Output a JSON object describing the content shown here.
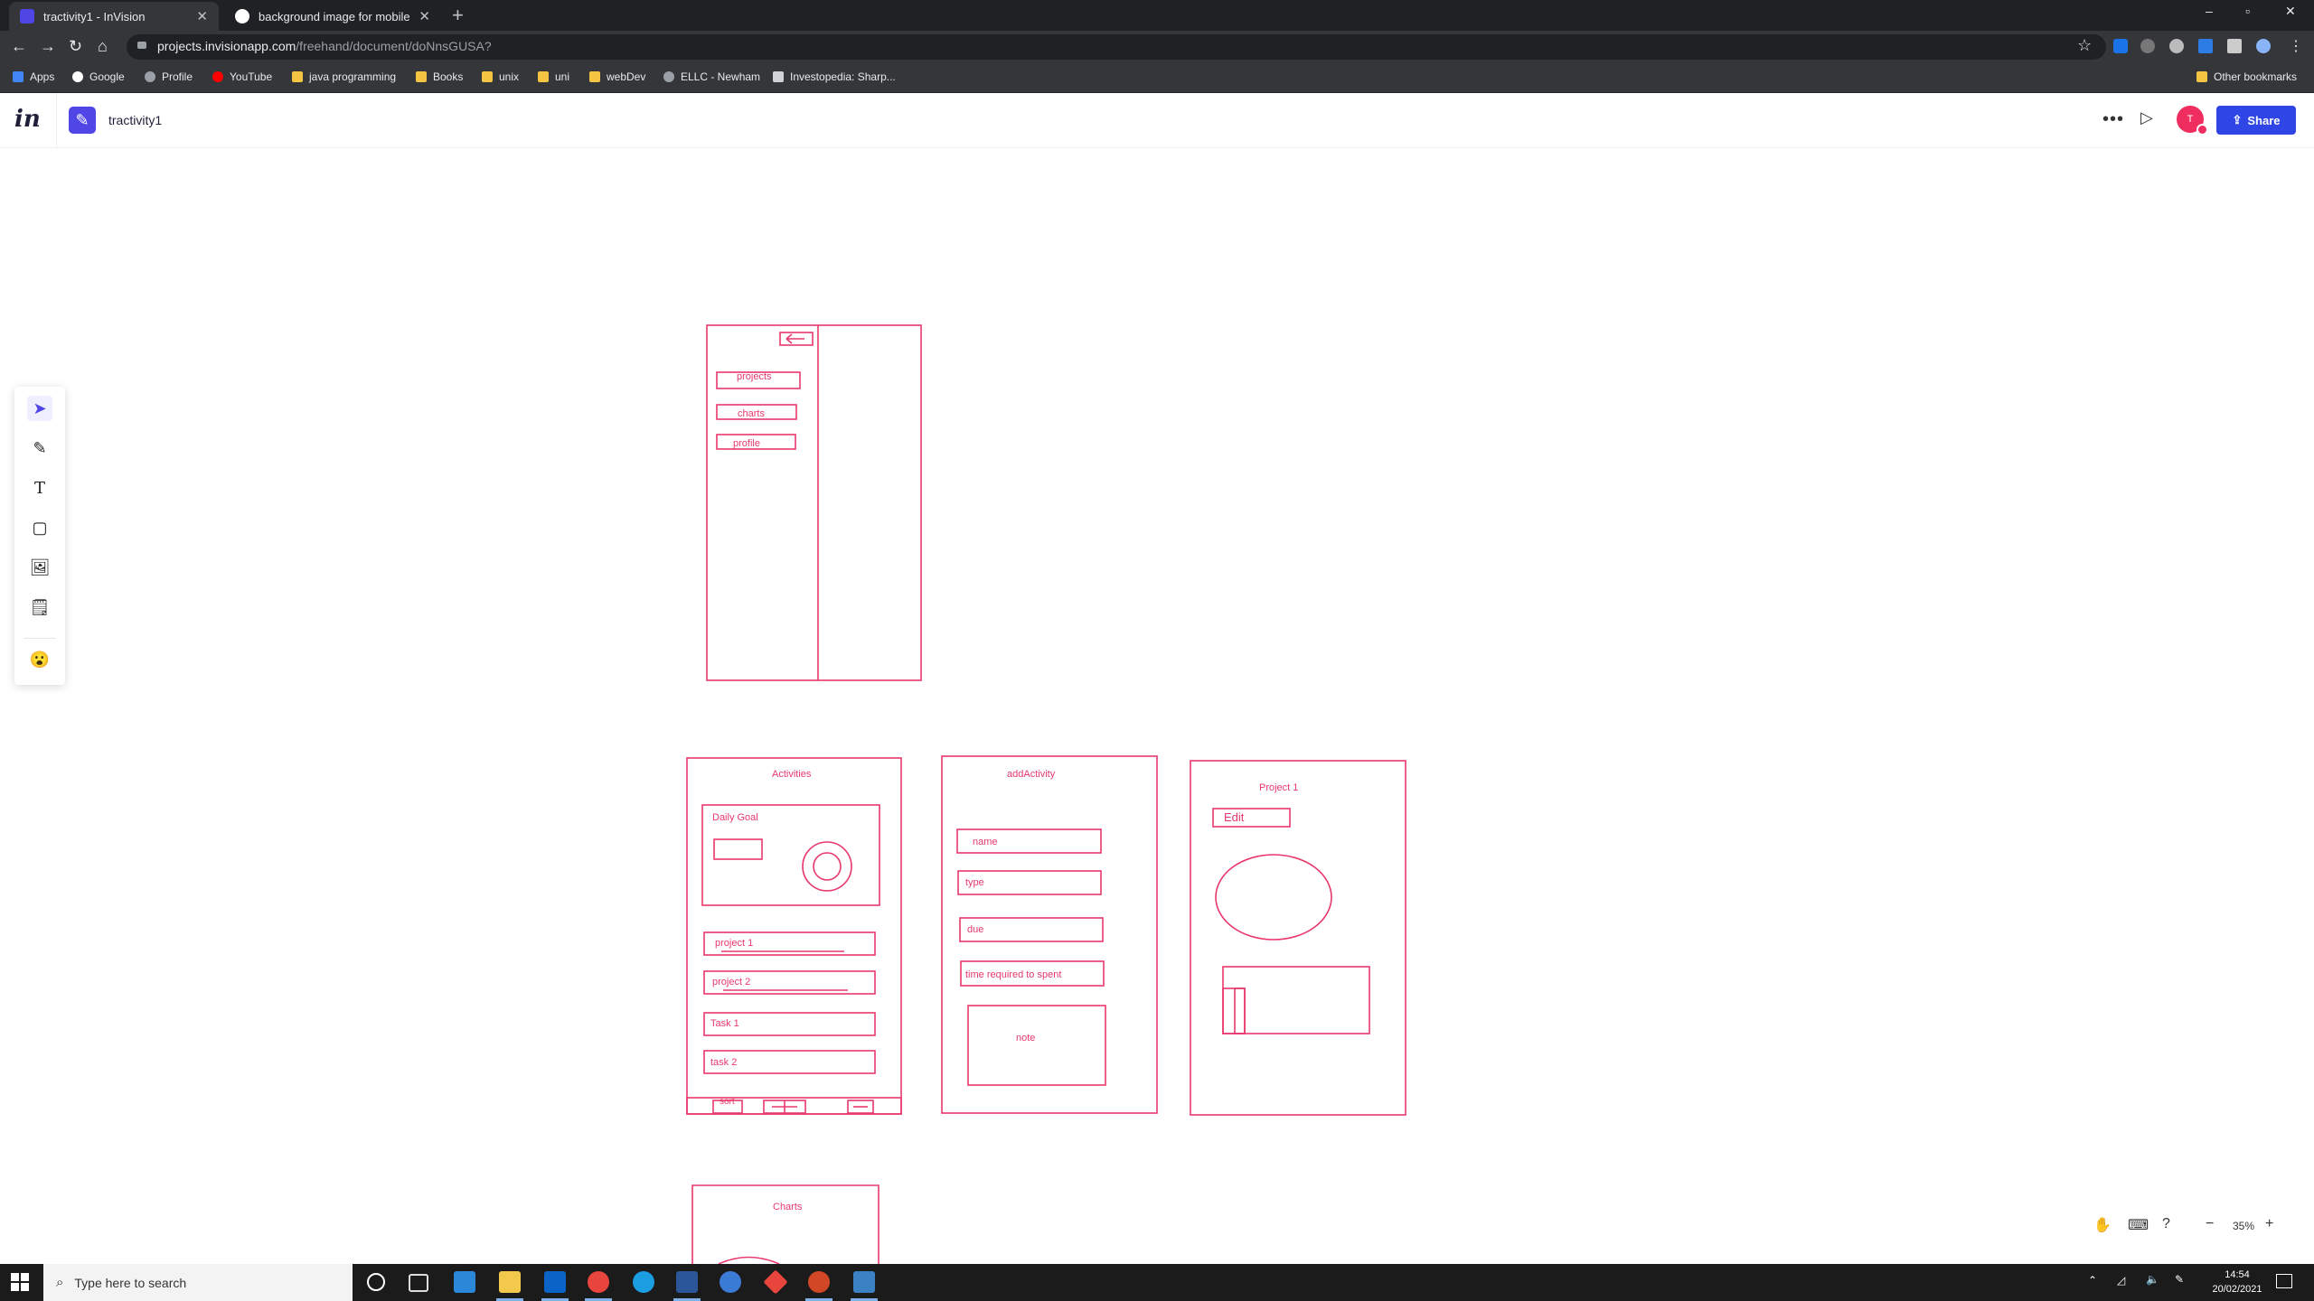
{
  "browser": {
    "tabs": [
      {
        "title": "tractivity1 - InVision",
        "active": true
      },
      {
        "title": "background image for mobile ap",
        "active": false
      }
    ],
    "new_tab": "+",
    "window_controls": [
      "–",
      "▫",
      "✕"
    ],
    "nav": {
      "back": "←",
      "forward": "→",
      "reload": "↻",
      "home": "⌂"
    },
    "url_host": "projects.invisionapp.com",
    "url_path": "/freehand/document/doNnsGUSA?",
    "star": "☆",
    "bookmarks": [
      {
        "label": "Apps",
        "icon": "apps-grid-icon"
      },
      {
        "label": "Google",
        "icon": "google-icon"
      },
      {
        "label": "Profile",
        "icon": "globe-icon"
      },
      {
        "label": "YouTube",
        "icon": "youtube-icon"
      },
      {
        "label": "java programming",
        "icon": "folder-icon"
      },
      {
        "label": "Books",
        "icon": "folder-icon"
      },
      {
        "label": "unix",
        "icon": "folder-icon"
      },
      {
        "label": "uni",
        "icon": "folder-icon"
      },
      {
        "label": "webDev",
        "icon": "folder-icon"
      },
      {
        "label": "ELLC - Newham",
        "icon": "globe-icon"
      },
      {
        "label": "Investopedia: Sharp...",
        "icon": "investopedia-icon"
      }
    ],
    "other_bookmarks": "Other bookmarks"
  },
  "invision": {
    "logo": "in",
    "doc_title": "tractivity1",
    "avatar_initial": "T",
    "share_label": "Share",
    "more": "•••",
    "play": "▷"
  },
  "tools": [
    "select",
    "pen",
    "text",
    "rectangle",
    "image",
    "sticky-note",
    "emoji"
  ],
  "canvas": {
    "nav_drawer": {
      "items": [
        "projects",
        "charts",
        "profile"
      ]
    },
    "activities": {
      "title": "Activities",
      "daily_goal": "Daily Goal",
      "rows": [
        "project 1",
        "project 2",
        "Task 1",
        "task 2"
      ],
      "bottom_bar": {
        "sort": "sort"
      }
    },
    "add_activity": {
      "title": "addActivity",
      "fields": [
        "name",
        "type",
        "due",
        "time required to spent"
      ],
      "note": "note"
    },
    "project1": {
      "title": "Project 1",
      "edit": "Edit"
    },
    "charts": {
      "title": "Charts"
    }
  },
  "zoom": {
    "value": "35%",
    "minus": "−",
    "plus": "+"
  },
  "taskbar": {
    "search_placeholder": "Type here to search",
    "time": "14:54",
    "date": "20/02/2021"
  },
  "colors": {
    "sketch": "#e8386c",
    "share": "#2f45e6",
    "accent": "#4f46e5"
  }
}
